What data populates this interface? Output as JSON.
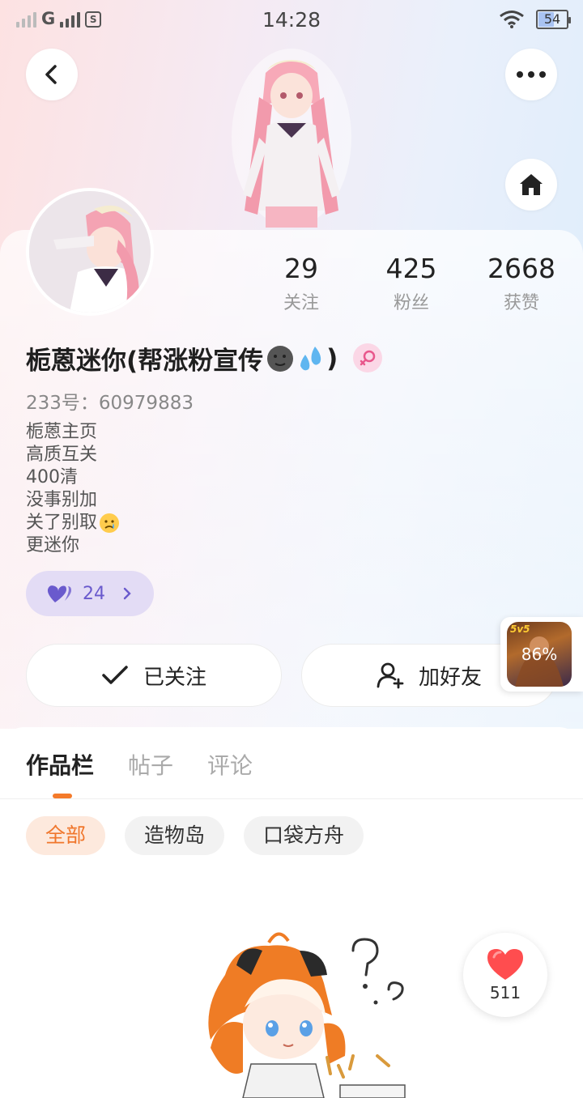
{
  "status_bar": {
    "network": "G",
    "time": "14:28",
    "battery": "54",
    "battery_level": 0.54
  },
  "header": {
    "back_icon": "chevron-left-icon",
    "more_icon": "more-dots-icon",
    "home_icon": "home-icon"
  },
  "profile": {
    "stats": [
      {
        "value": "29",
        "label": "关注"
      },
      {
        "value": "425",
        "label": "粉丝"
      },
      {
        "value": "2668",
        "label": "获赞"
      }
    ],
    "name": "栀蒽迷你(帮涨粉宣传",
    "name_suffix": ")",
    "gender": "female",
    "uid": "233号：60979883",
    "bio_lines": [
      "栀蒽主页",
      "高质互关",
      "400清",
      "没事别加",
      "关了别取",
      "更迷你"
    ],
    "likes_pill": "24"
  },
  "actions": {
    "followed_label": "已关注",
    "add_friend_label": "加好友"
  },
  "floating_game": {
    "progress": "86%",
    "tag": "5v5"
  },
  "tabs": [
    {
      "label": "作品栏",
      "active": true
    },
    {
      "label": "帖子",
      "active": false
    },
    {
      "label": "评论",
      "active": false
    }
  ],
  "chips": [
    {
      "label": "全部",
      "active": true
    },
    {
      "label": "造物岛",
      "active": false
    },
    {
      "label": "口袋方舟",
      "active": false
    }
  ],
  "like_fab": {
    "count": "511"
  },
  "colors": {
    "accent_orange": "#f47a2a",
    "like_red": "#ff4d4f",
    "purple": "#6a5acd"
  }
}
